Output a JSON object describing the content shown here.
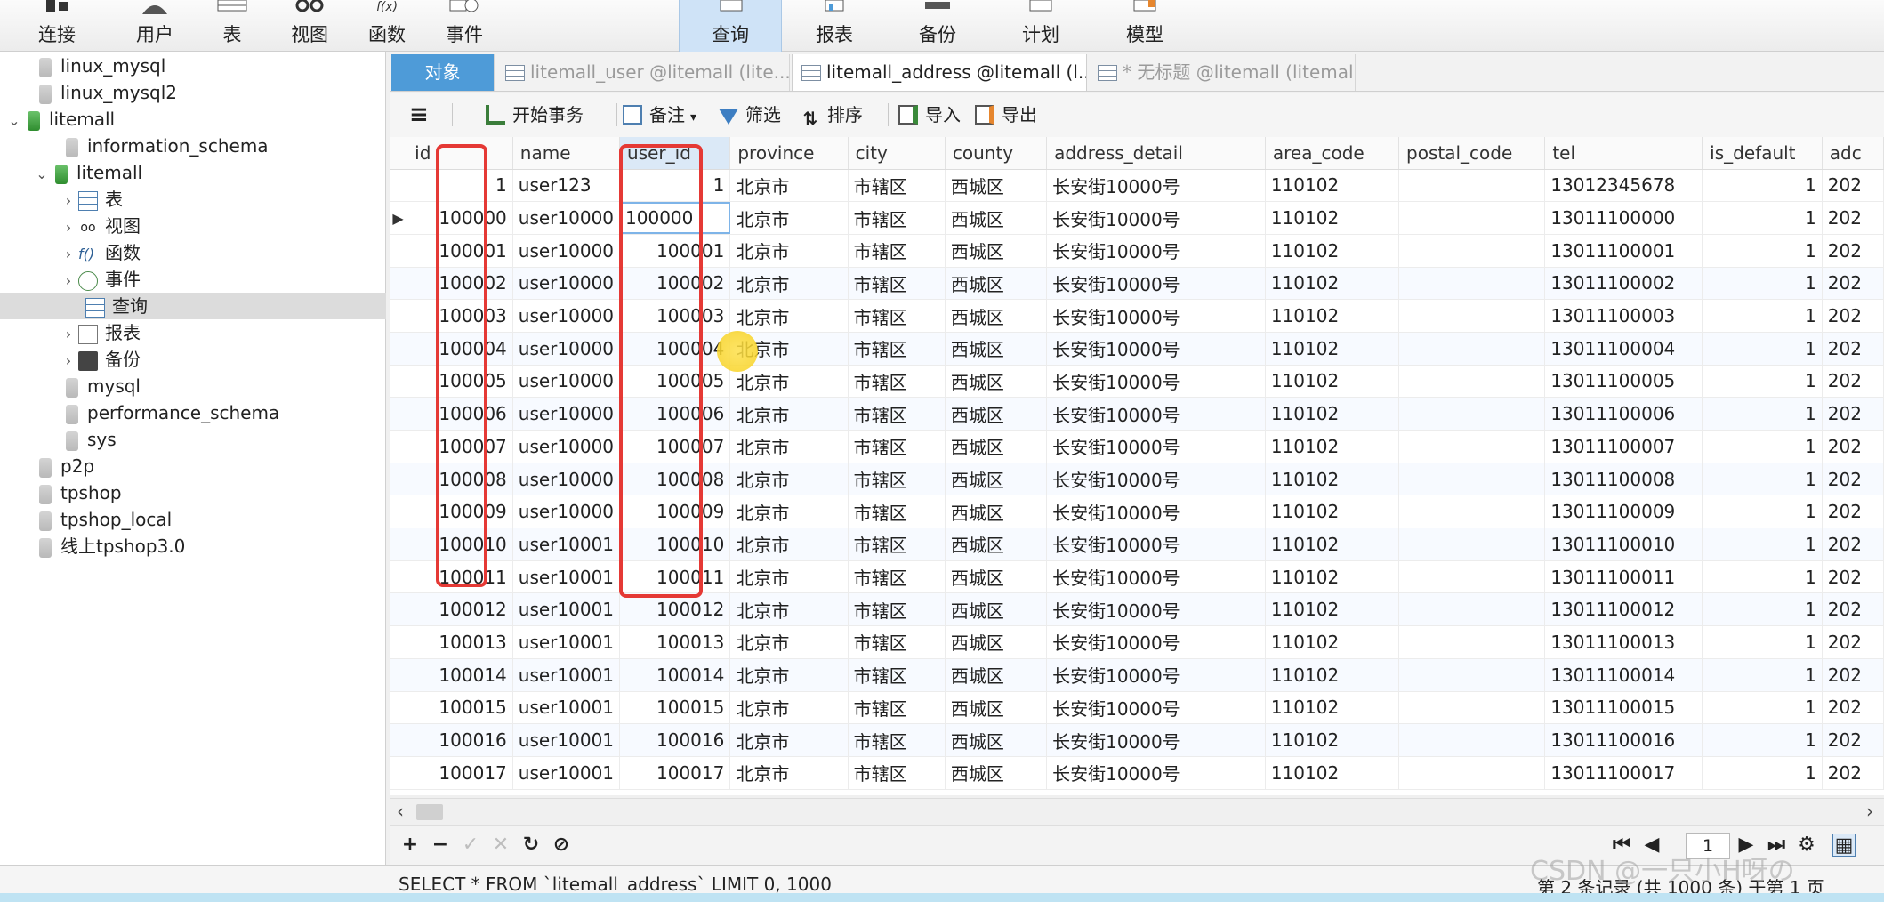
{
  "toolbar": {
    "items": [
      {
        "label": "连接",
        "icon": "plug-icon"
      },
      {
        "label": "用户",
        "icon": "user-icon"
      },
      {
        "label": "表",
        "icon": "table-icon"
      },
      {
        "label": "视图",
        "icon": "glasses-icon"
      },
      {
        "label": "函数",
        "icon": "function-icon"
      },
      {
        "label": "事件",
        "icon": "clock-icon"
      },
      {
        "label": "查询",
        "icon": "query-icon",
        "active": true
      },
      {
        "label": "报表",
        "icon": "report-icon"
      },
      {
        "label": "备份",
        "icon": "backup-icon"
      },
      {
        "label": "计划",
        "icon": "schedule-icon"
      },
      {
        "label": "模型",
        "icon": "model-icon"
      }
    ]
  },
  "sidebar": {
    "items": [
      {
        "label": "linux_mysql"
      },
      {
        "label": "linux_mysql2"
      },
      {
        "label": "litemall"
      },
      {
        "label": "information_schema"
      },
      {
        "label": "litemall"
      },
      {
        "label": "表"
      },
      {
        "label": "视图"
      },
      {
        "label": "函数"
      },
      {
        "label": "事件"
      },
      {
        "label": "查询"
      },
      {
        "label": "报表"
      },
      {
        "label": "备份"
      },
      {
        "label": "mysql"
      },
      {
        "label": "performance_schema"
      },
      {
        "label": "sys"
      },
      {
        "label": "p2p"
      },
      {
        "label": "tpshop"
      },
      {
        "label": "tpshop_local"
      },
      {
        "label": "线上tpshop3.0"
      }
    ]
  },
  "tabs": [
    {
      "label": "对象"
    },
    {
      "label": "litemall_user @litemall (lite..."
    },
    {
      "label": "litemall_address @litemall (l..."
    },
    {
      "label": "* 无标题 @litemall (litemall) ..."
    }
  ],
  "subtoolbar": {
    "begin_tx": "开始事务",
    "note": "备注",
    "filter": "筛选",
    "sort": "排序",
    "import": "导入",
    "export": "导出"
  },
  "grid": {
    "columns": [
      "id",
      "name",
      "user_id",
      "province",
      "city",
      "county",
      "address_detail",
      "area_code",
      "postal_code",
      "tel",
      "is_default",
      "adc"
    ],
    "rows": [
      [
        "1",
        "user123",
        "1",
        "北京市",
        "市辖区",
        "西城区",
        "长安街10000号",
        "110102",
        "",
        "13012345678",
        "1",
        "202"
      ],
      [
        "100000",
        "user10000",
        "100000",
        "北京市",
        "市辖区",
        "西城区",
        "长安街10000号",
        "110102",
        "",
        "13011100000",
        "1",
        "202"
      ],
      [
        "100001",
        "user10000",
        "100001",
        "北京市",
        "市辖区",
        "西城区",
        "长安街10000号",
        "110102",
        "",
        "13011100001",
        "1",
        "202"
      ],
      [
        "100002",
        "user10000",
        "100002",
        "北京市",
        "市辖区",
        "西城区",
        "长安街10000号",
        "110102",
        "",
        "13011100002",
        "1",
        "202"
      ],
      [
        "100003",
        "user10000",
        "100003",
        "北京市",
        "市辖区",
        "西城区",
        "长安街10000号",
        "110102",
        "",
        "13011100003",
        "1",
        "202"
      ],
      [
        "100004",
        "user10000",
        "100004",
        "北京市",
        "市辖区",
        "西城区",
        "长安街10000号",
        "110102",
        "",
        "13011100004",
        "1",
        "202"
      ],
      [
        "100005",
        "user10000",
        "100005",
        "北京市",
        "市辖区",
        "西城区",
        "长安街10000号",
        "110102",
        "",
        "13011100005",
        "1",
        "202"
      ],
      [
        "100006",
        "user10000",
        "100006",
        "北京市",
        "市辖区",
        "西城区",
        "长安街10000号",
        "110102",
        "",
        "13011100006",
        "1",
        "202"
      ],
      [
        "100007",
        "user10000",
        "100007",
        "北京市",
        "市辖区",
        "西城区",
        "长安街10000号",
        "110102",
        "",
        "13011100007",
        "1",
        "202"
      ],
      [
        "100008",
        "user10000",
        "100008",
        "北京市",
        "市辖区",
        "西城区",
        "长安街10000号",
        "110102",
        "",
        "13011100008",
        "1",
        "202"
      ],
      [
        "100009",
        "user10000",
        "100009",
        "北京市",
        "市辖区",
        "西城区",
        "长安街10000号",
        "110102",
        "",
        "13011100009",
        "1",
        "202"
      ],
      [
        "100010",
        "user10001",
        "100010",
        "北京市",
        "市辖区",
        "西城区",
        "长安街10000号",
        "110102",
        "",
        "13011100010",
        "1",
        "202"
      ],
      [
        "100011",
        "user10001",
        "100011",
        "北京市",
        "市辖区",
        "西城区",
        "长安街10000号",
        "110102",
        "",
        "13011100011",
        "1",
        "202"
      ],
      [
        "100012",
        "user10001",
        "100012",
        "北京市",
        "市辖区",
        "西城区",
        "长安街10000号",
        "110102",
        "",
        "13011100012",
        "1",
        "202"
      ],
      [
        "100013",
        "user10001",
        "100013",
        "北京市",
        "市辖区",
        "西城区",
        "长安街10000号",
        "110102",
        "",
        "13011100013",
        "1",
        "202"
      ],
      [
        "100014",
        "user10001",
        "100014",
        "北京市",
        "市辖区",
        "西城区",
        "长安街10000号",
        "110102",
        "",
        "13011100014",
        "1",
        "202"
      ],
      [
        "100015",
        "user10001",
        "100015",
        "北京市",
        "市辖区",
        "西城区",
        "长安街10000号",
        "110102",
        "",
        "13011100015",
        "1",
        "202"
      ],
      [
        "100016",
        "user10001",
        "100016",
        "北京市",
        "市辖区",
        "西城区",
        "长安街10000号",
        "110102",
        "",
        "13011100016",
        "1",
        "202"
      ],
      [
        "100017",
        "user10001",
        "100017",
        "北京市",
        "市辖区",
        "西城区",
        "长安街10000号",
        "110102",
        "",
        "13011100017",
        "1",
        "202"
      ]
    ],
    "editing_value": "100000"
  },
  "nav": {
    "page": "1"
  },
  "status": {
    "sql": "SELECT * FROM `litemall_address` LIMIT 0, 1000",
    "records": "第 2 条记录 (共 1000 条) 于第 1 页"
  },
  "watermark": "CSDN @一只小H呀の",
  "colors": {
    "accent": "#4e9bd8",
    "highlight": "#e53935",
    "cursor": "#f6cf19"
  }
}
